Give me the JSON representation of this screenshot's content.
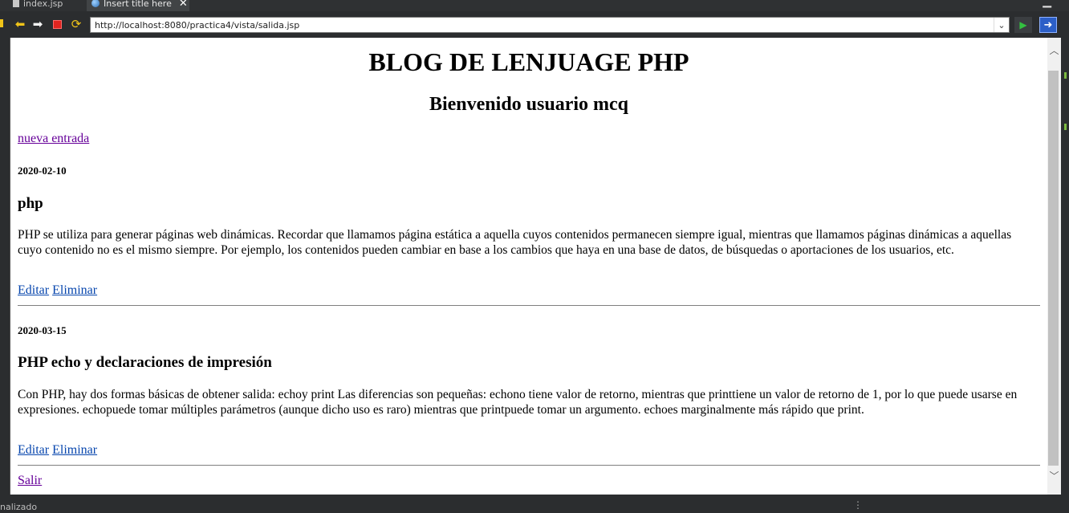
{
  "tabs": [
    {
      "label": "index.jsp"
    },
    {
      "label": "Insert title here"
    }
  ],
  "toolbar": {
    "url": "http://localhost:8080/practica4/vista/salida.jsp"
  },
  "page": {
    "heading": "BLOG DE LENJUAGE PHP",
    "welcome": "Bienvenido usuario mcq",
    "new_entry_link": "nueva entrada",
    "posts": [
      {
        "date": "2020-02-10",
        "title": "php",
        "body": "PHP se utiliza para generar páginas web dinámicas. Recordar que llamamos página estática a aquella cuyos contenidos permanecen siempre igual, mientras que llamamos páginas dinámicas a aquellas cuyo contenido no es el mismo siempre. Por ejemplo, los contenidos pueden cambiar en base a los cambios que haya en una base de datos, de búsquedas o aportaciones de los usuarios, etc.",
        "edit_label": "Editar",
        "delete_label": "Eliminar"
      },
      {
        "date": "2020-03-15",
        "title": "PHP echo y declaraciones de impresión",
        "body": "Con PHP, hay dos formas básicas de obtener salida: echoy print Las diferencias son pequeñas: echono tiene valor de retorno, mientras que printtiene un valor de retorno de 1, por lo que puede usarse en expresiones. echopuede tomar múltiples parámetros (aunque dicho uso es raro) mientras que printpuede tomar un argumento. echoes marginalmente más rápido que print.",
        "edit_label": "Editar",
        "delete_label": "Eliminar"
      }
    ],
    "logout_link": "Salir"
  },
  "statusbar": {
    "text": "nalizado"
  },
  "colors": {
    "link": "#0645ad",
    "visited_link": "#660099",
    "chrome_bg": "#2b2d2f"
  }
}
